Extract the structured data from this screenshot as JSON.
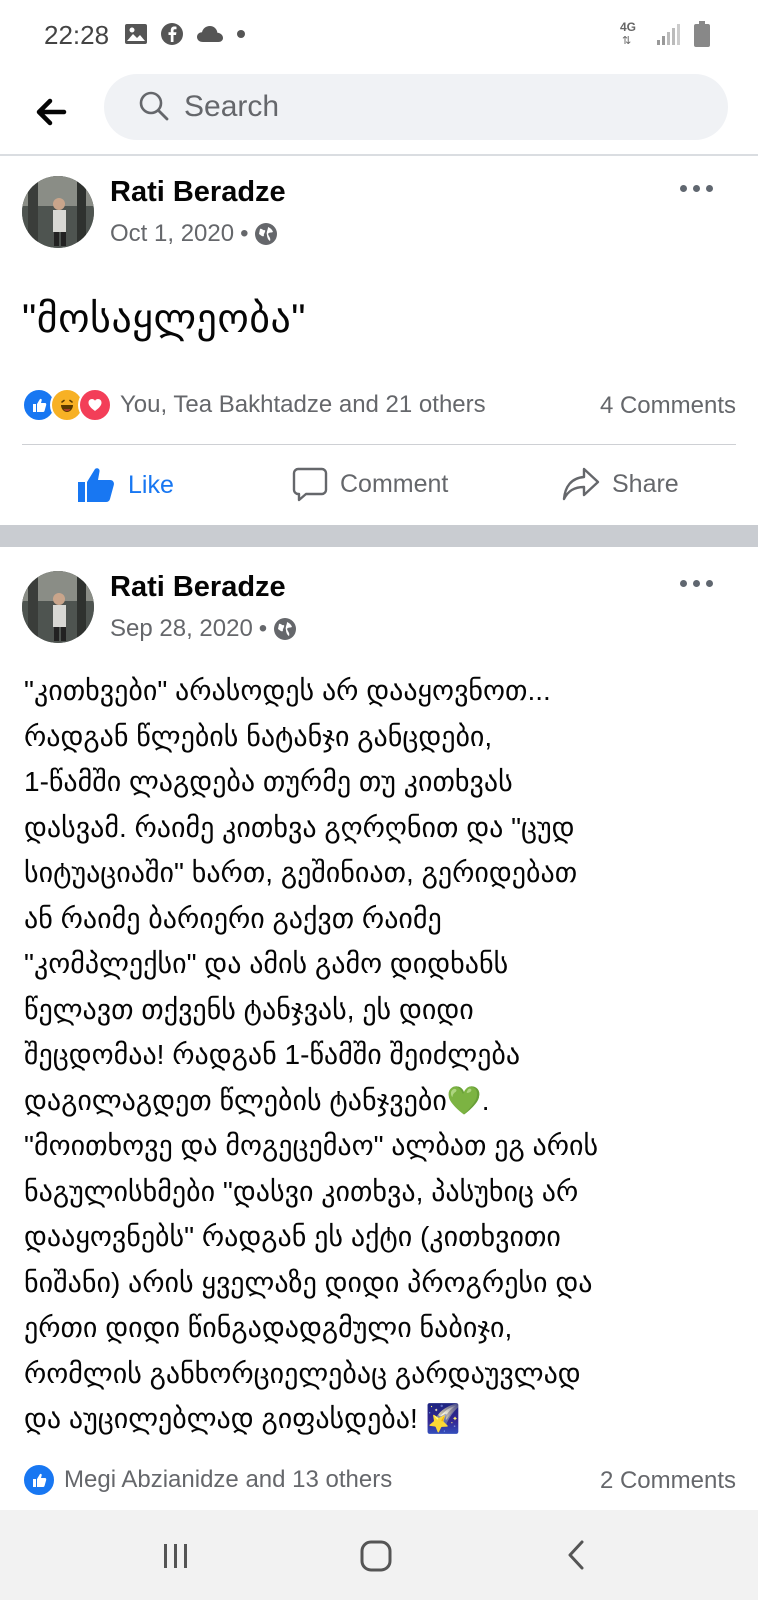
{
  "status_bar": {
    "time": "22:28",
    "left_icons": [
      "image-icon",
      "facebook-icon",
      "cloud-icon",
      "dot-icon"
    ],
    "right_icons": [
      "4g-icon",
      "signal-icon",
      "battery-icon"
    ],
    "network_label": "4G"
  },
  "search": {
    "placeholder": "Search"
  },
  "posts": [
    {
      "author": "Rati Beradze",
      "date": "Oct 1, 2020",
      "separator": "•",
      "text": "\"მოსაყლეობა\"",
      "reactions_text": "You, Tea Bakhtadze and 21 others",
      "reaction_types": [
        "like",
        "haha",
        "love"
      ],
      "comments": "4 Comments",
      "actions": {
        "like": "Like",
        "comment": "Comment",
        "share": "Share"
      }
    },
    {
      "author": "Rati Beradze",
      "date": "Sep 28, 2020",
      "separator": "•",
      "text": "\"კითხვები\" არასოდეს არ დააყოვნოთ...\nრადგან წლების ნატანჯი განცდები,\n1-წამში ლაგდება თურმე თუ კითხვას\nდასვამ. რაიმე კითხვა გღრღნით და \"ცუდ\nსიტუაციაში\" ხართ, გეშინიათ, გერიდებათ\nან რაიმე ბარიერი გაქვთ რაიმე\n\"კომპლექსი\" და ამის გამო დიდხანს\nწელავთ თქვენს ტანჯვას, ეს დიდი\nშეცდომაა! რადგან 1-წამში შეიძლება\nდაგილაგდეთ წლების ტანჯვები💚.\n\"მოითხოვე და მოგეცემაო\" ალბათ ეგ არის\nნაგულისხმები \"დასვი კითხვა, პასუხიც არ\nდააყოვნებს\" რადგან ეს აქტი (კითხვითი\nნიშანი)  არის ყველაზე დიდი პროგრესი და\nერთი დიდი წინგადადგმული ნაბიჯი,\nრომლის განხორციელებაც გარდაუვლად\nდა აუცილებლად გიფასდება! 🌠",
      "reactions_text": "Megi Abzianidze and 13 others",
      "comments": "2 Comments"
    }
  ],
  "colors": {
    "facebook_blue": "#1877f2",
    "secondary_text": "#65676b",
    "separator": "#c9ccd1",
    "love_red": "#f33e58",
    "haha_yellow": "#f7b125"
  }
}
